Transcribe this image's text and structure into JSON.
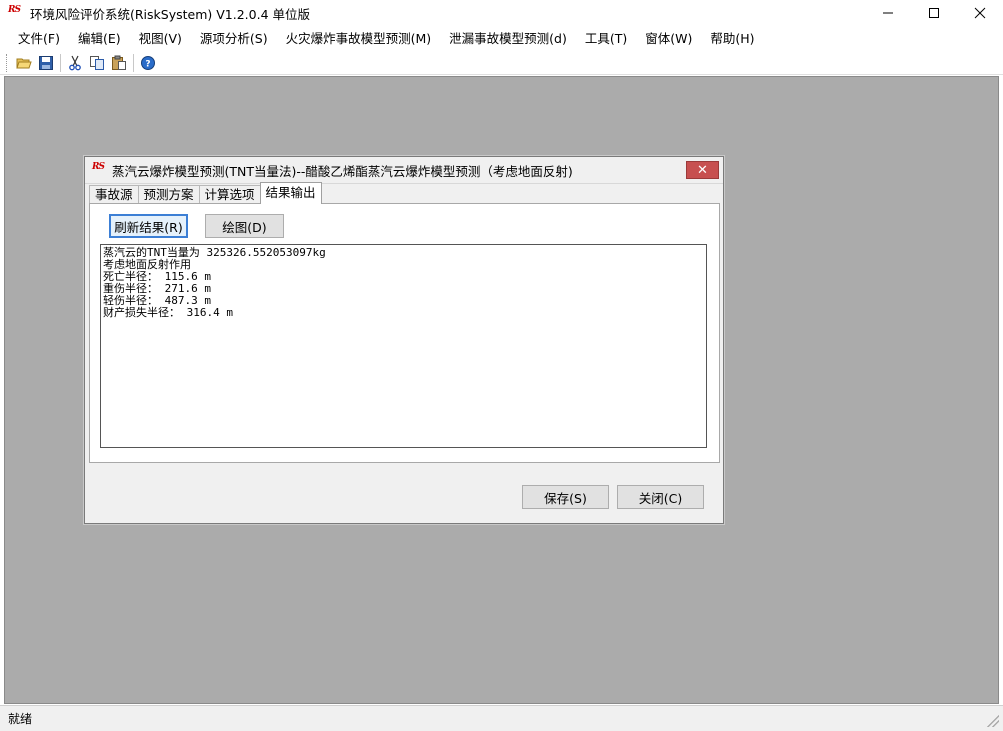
{
  "app": {
    "title": "环境风险评价系统(RiskSystem) V1.2.0.4 单位版",
    "icon_text": "RS"
  },
  "window_controls": {
    "minimize": "—",
    "maximize": "☐",
    "close": "✕"
  },
  "menu": [
    {
      "label": "文件(F)"
    },
    {
      "label": "编辑(E)"
    },
    {
      "label": "视图(V)"
    },
    {
      "label": "源项分析(S)"
    },
    {
      "label": "火灾爆炸事故模型预测(M)"
    },
    {
      "label": "泄漏事故模型预测(d)"
    },
    {
      "label": "工具(T)"
    },
    {
      "label": "窗体(W)"
    },
    {
      "label": "帮助(H)"
    }
  ],
  "toolbar": {
    "icons": [
      "open-folder-icon",
      "save-icon",
      "cut-icon",
      "copy-icon",
      "paste-icon",
      "help-icon"
    ]
  },
  "dialog": {
    "title": "蒸汽云爆炸模型预测(TNT当量法)--醋酸乙烯酯蒸汽云爆炸模型预测（考虑地面反射)",
    "close": "✕",
    "tabs": [
      {
        "label": "事故源",
        "active": false
      },
      {
        "label": "预测方案",
        "active": false
      },
      {
        "label": "计算选项",
        "active": false
      },
      {
        "label": "结果输出",
        "active": true
      }
    ],
    "refresh_button": "刷新结果(R)",
    "plot_button": "绘图(D)",
    "output_lines": [
      "蒸汽云的TNT当量为 325326.552053097kg",
      "考虑地面反射作用",
      "死亡半径： 115.6 m",
      "重伤半径： 271.6 m",
      "轻伤半径： 487.3 m",
      "财产损失半径： 316.4 m"
    ],
    "save_button": "保存(S)",
    "close_button": "关闭(C)"
  },
  "status": {
    "text": "就绪"
  },
  "colors": {
    "workspace": "#ababab",
    "dialog_bg": "#f0f0f0",
    "close_red": "#c75050",
    "focus_blue": "#3c7fd5"
  }
}
